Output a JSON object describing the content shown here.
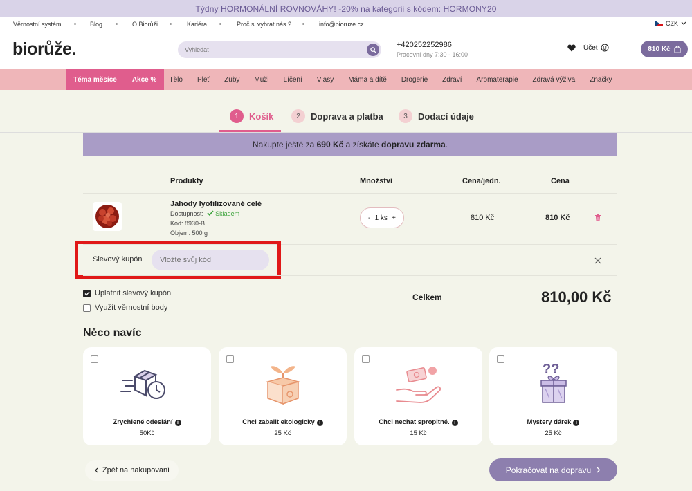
{
  "promo": "Týdny HORMONÁLNÍ ROVNOVÁHY! -20% na kategorii s kódem: HORMONY20",
  "top_links": [
    "Věrnostní systém",
    "Blog",
    "O Biorůži",
    "Kariéra",
    "Proč si vybrat nás ?",
    "info@bioruze.cz"
  ],
  "currency": "CZK",
  "header": {
    "logo": "biorůže.",
    "search_placeholder": "Vyhledat",
    "phone": "+420252252986",
    "hours": "Pracovní dny 7:30 - 16:00",
    "account": "Účet",
    "cart_total": "810 Kč"
  },
  "nav": {
    "special": [
      "Téma měsíce",
      "Akce %"
    ],
    "items": [
      "Tělo",
      "Pleť",
      "Zuby",
      "Muži",
      "Líčení",
      "Vlasy",
      "Máma a dítě",
      "Drogerie",
      "Zdraví",
      "Aromaterapie",
      "Zdravá výživa",
      "Značky"
    ]
  },
  "steps": [
    {
      "num": "1",
      "label": "Košík"
    },
    {
      "num": "2",
      "label": "Doprava a platba"
    },
    {
      "num": "3",
      "label": "Dodací údaje"
    }
  ],
  "free_shipping": {
    "prefix": "Nakupte ještě za ",
    "amount": "690 Kč",
    "middle": " a získáte ",
    "bold": "dopravu zdarma",
    "suffix": "."
  },
  "table_headers": {
    "products": "Produkty",
    "quantity": "Množství",
    "unit_price": "Cena/jedn.",
    "price": "Cena"
  },
  "product": {
    "name": "Jahody lyofilizované celé",
    "availability_label": "Dostupnost:",
    "availability_value": "Skladem",
    "code": "Kód: 8930-B",
    "volume": "Objem: 500 g",
    "qty_minus": "-",
    "qty": "1 ks",
    "qty_plus": "+",
    "unit_price": "810 Kč",
    "price": "810 Kč"
  },
  "coupon": {
    "label": "Slevový kupón",
    "placeholder": "Vložte svůj kód"
  },
  "options": [
    {
      "label": "Uplatnit slevový kupón",
      "checked": true
    },
    {
      "label": "Využít věrnostní body",
      "checked": false
    }
  ],
  "total": {
    "label": "Celkem",
    "value": "810,00 Kč"
  },
  "extras": {
    "title": "Něco navíc",
    "cards": [
      {
        "title": "Zrychlené odeslání",
        "price": "50Kč",
        "icon": "fast-delivery-icon"
      },
      {
        "title": "Chci zabalit ekologicky",
        "price": "25 Kč",
        "icon": "eco-box-icon"
      },
      {
        "title": "Chci nechat spropitné.",
        "price": "15 Kč",
        "icon": "tip-hand-icon"
      },
      {
        "title": "Mystery dárek",
        "price": "25 Kč",
        "icon": "mystery-gift-icon"
      }
    ],
    "info_glyph": "i"
  },
  "buttons": {
    "back": "Zpět na nakupování",
    "continue": "Pokračovat na dopravu"
  },
  "colors": {
    "accent_pink": "#e05d8d",
    "purple": "#7b6b9d",
    "highlight_red": "#e01818"
  }
}
